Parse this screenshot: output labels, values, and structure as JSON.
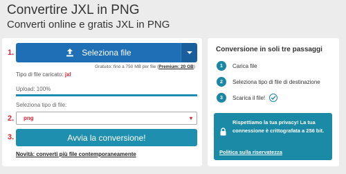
{
  "header": {
    "title": "Convertire JXL in PNG",
    "subtitle": "Converti online e gratis JXL in PNG"
  },
  "converter": {
    "steps": [
      "1.",
      "2.",
      "3."
    ],
    "select_file_label": "Seleziona file",
    "limit_text": "Gratuito: fino a 750 MB per file",
    "limit_premium": "Premium: 20 GB",
    "uploaded_type_label": "Tipo di file caricato:",
    "uploaded_type_value": "jxl",
    "upload_progress_text": "Upload: 100%",
    "upload_progress": 1.0,
    "select_type_label": "Seleziona tipo di file:",
    "selected_format": "png",
    "convert_label": "Avvia la conversione!",
    "news_link": "Novità: converti più file contemporaneamente"
  },
  "steps_panel": {
    "title": "Conversione in soli tre passaggi",
    "items": [
      {
        "num": "1",
        "text": "Carica file"
      },
      {
        "num": "2",
        "text": "Seleziona tipo di file di destinazione"
      },
      {
        "num": "3",
        "text": "Scarica il file!"
      }
    ]
  },
  "privacy": {
    "text": "Rispettiamo la tua privacy! La tua connessione è crittografata a 256 bit.",
    "link": "Politica sulla riservatezza"
  },
  "colors": {
    "primary_blue": "#1f6fb6",
    "teal": "#1b87a6",
    "accent_red": "#e0232e"
  },
  "icons": [
    "upload-icon",
    "chevron-down-icon",
    "check-circle-icon",
    "lock-icon"
  ]
}
